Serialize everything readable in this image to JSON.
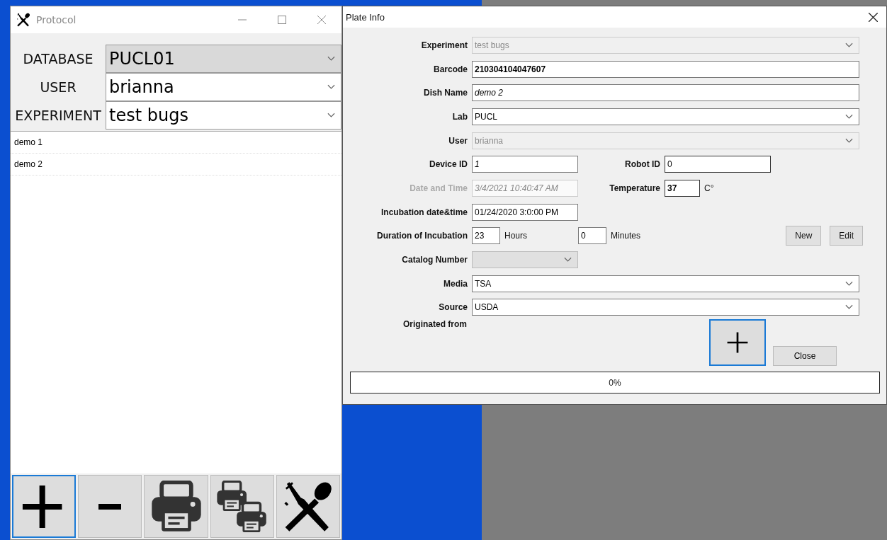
{
  "protocol_window": {
    "title": "Protocol",
    "selectors": [
      {
        "label": "DATABASE",
        "value": "PUCL01",
        "disabled": true
      },
      {
        "label": "USER",
        "value": "brianna",
        "disabled": false
      },
      {
        "label": "EXPERIMENT",
        "value": "test bugs",
        "disabled": false
      }
    ],
    "list": [
      {
        "label": "demo 1"
      },
      {
        "label": "demo 2"
      }
    ],
    "toolbar": [
      {
        "kind": "add",
        "focused": true
      },
      {
        "kind": "remove",
        "focused": false
      },
      {
        "kind": "print",
        "focused": false
      },
      {
        "kind": "print-all",
        "focused": false
      },
      {
        "kind": "utensils",
        "focused": false
      }
    ]
  },
  "plate_info_window": {
    "title": "Plate Info",
    "rows": [
      {
        "items": [
          {
            "kind": "label",
            "text": "Experiment"
          },
          {
            "kind": "combo",
            "value": "test bugs",
            "disabled": true
          }
        ]
      },
      {
        "items": [
          {
            "kind": "label",
            "text": "Barcode"
          },
          {
            "kind": "boldtext",
            "value": "210304104047607"
          }
        ]
      },
      {
        "items": [
          {
            "kind": "label",
            "text": "Dish Name"
          },
          {
            "kind": "italictext",
            "value": "demo 2"
          }
        ]
      },
      {
        "items": [
          {
            "kind": "label",
            "text": "Lab"
          },
          {
            "kind": "combo",
            "value": "PUCL",
            "disabled": false
          }
        ]
      },
      {
        "items": [
          {
            "kind": "label",
            "text": "User"
          },
          {
            "kind": "combo",
            "value": "brianna",
            "disabled": true
          }
        ]
      },
      {
        "items": [
          {
            "kind": "label",
            "text": "Device ID"
          },
          {
            "kind": "italictext",
            "value": "1"
          },
          {
            "kind": "label2",
            "text": "Robot ID"
          },
          {
            "kind": "text",
            "value": "0"
          }
        ]
      },
      {
        "items": [
          {
            "kind": "label",
            "text": "Date and Time",
            "disabled": true
          },
          {
            "kind": "italictext",
            "value": "3/4/2021 10:40:47 AM",
            "disabled": true
          },
          {
            "kind": "label2",
            "text": "Temperature"
          },
          {
            "kind": "boldtext",
            "value": "37"
          },
          {
            "kind": "unit",
            "text": "C°"
          }
        ]
      },
      {
        "items": [
          {
            "kind": "label",
            "text": "Incubation date&time"
          },
          {
            "kind": "text",
            "value": "01/24/2020 3:0:00 PM"
          }
        ]
      },
      {
        "items": [
          {
            "kind": "label",
            "text": "Duration of Incubation"
          },
          {
            "kind": "text",
            "value": "23"
          },
          {
            "kind": "unit",
            "text": "Hours"
          },
          {
            "kind": "text",
            "value": "0"
          },
          {
            "kind": "unit",
            "text": "Minutes"
          },
          {
            "kind": "button",
            "text": "New"
          },
          {
            "kind": "button",
            "text": "Edit"
          }
        ]
      },
      {
        "items": [
          {
            "kind": "label",
            "text": "Catalog Number"
          },
          {
            "kind": "combo",
            "disabled": true
          }
        ]
      },
      {
        "items": [
          {
            "kind": "label",
            "text": "Media"
          },
          {
            "kind": "combo",
            "value": "TSA",
            "disabled": false
          }
        ]
      },
      {
        "items": [
          {
            "kind": "label",
            "text": "Source"
          },
          {
            "kind": "combo",
            "value": "USDA",
            "disabled": false
          }
        ]
      }
    ],
    "origin_label": "Originated from",
    "add_button": {
      "focused": true
    },
    "close_button": "Close",
    "progress": {
      "level": 0,
      "reading": "0%"
    }
  }
}
